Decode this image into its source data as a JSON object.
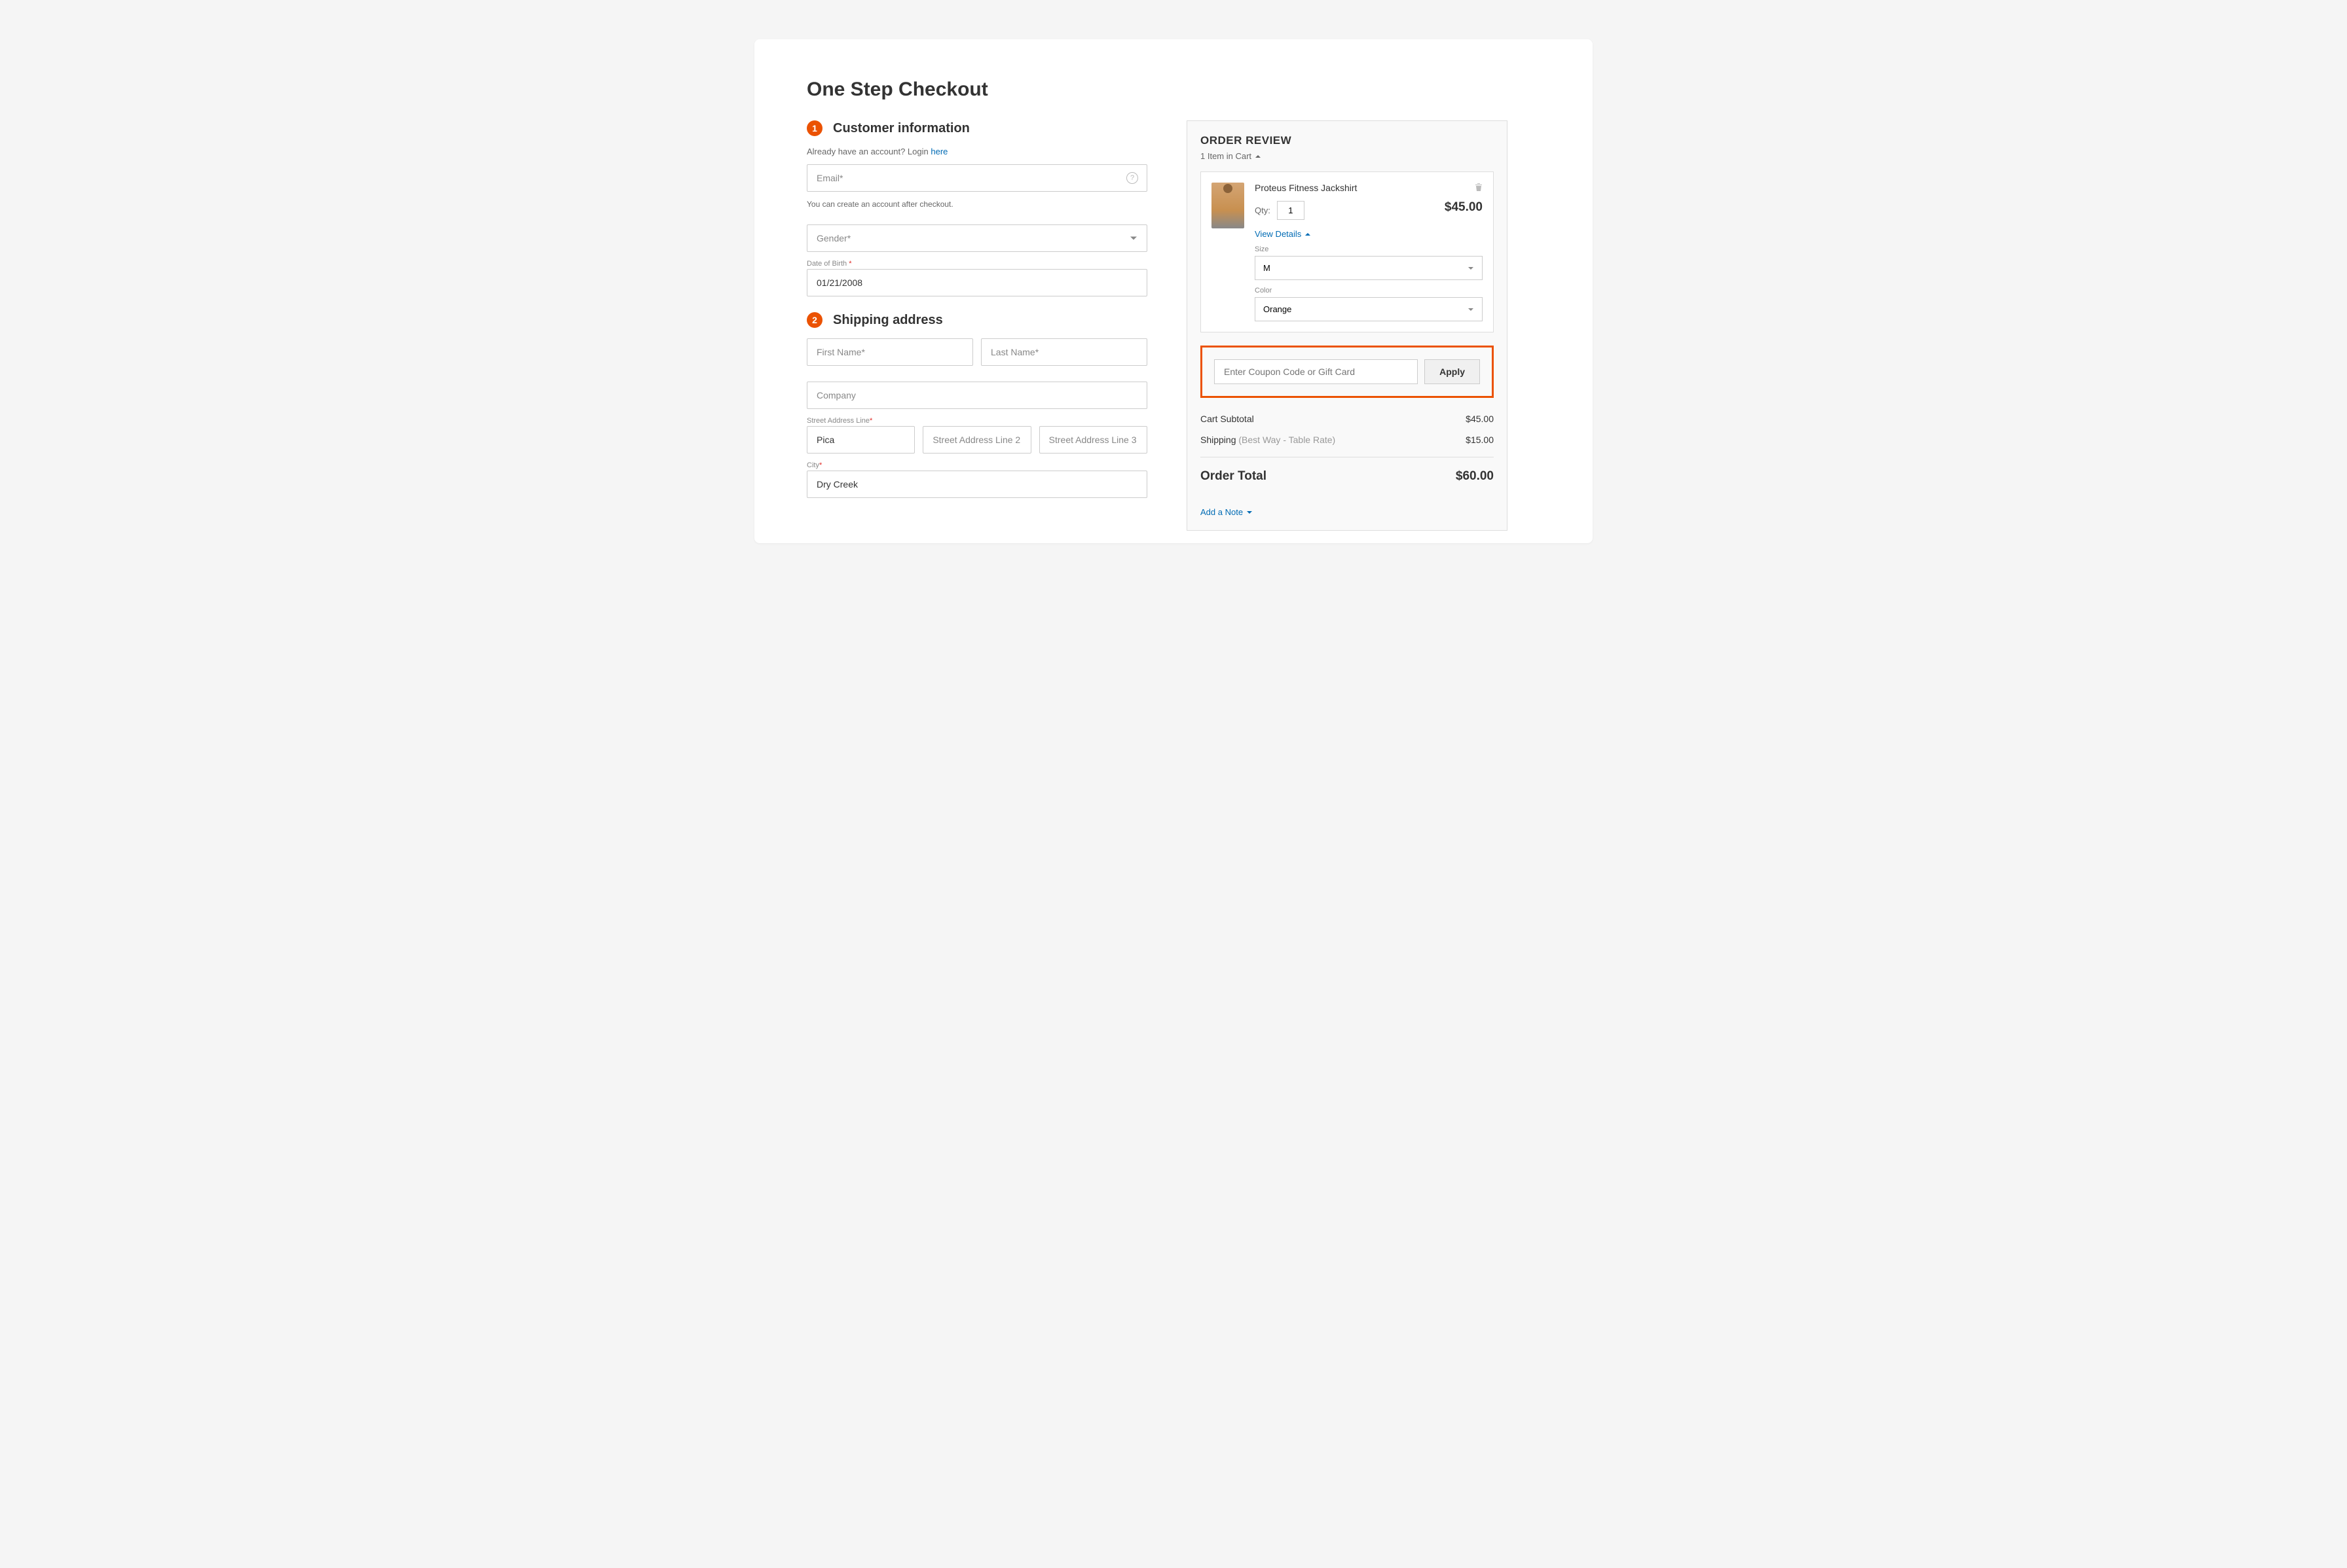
{
  "page": {
    "title": "One Step Checkout"
  },
  "customer": {
    "step": "1",
    "title": "Customer information",
    "login_prompt": "Already have an account? Login ",
    "login_link": "here",
    "email_placeholder": "Email",
    "email_note": "You can create an account after checkout.",
    "gender_placeholder": "Gender",
    "dob_label": "Date of Birth ",
    "dob_value": "01/21/2008"
  },
  "shipping": {
    "step": "2",
    "title": "Shipping address",
    "first_name_placeholder": "First Name",
    "last_name_placeholder": "Last Name",
    "company_placeholder": "Company",
    "street_label": "Street Address Line",
    "street1_value": "Pica",
    "street2_placeholder": "Street Address Line 2",
    "street3_placeholder": "Street Address Line 3",
    "city_label": "City",
    "city_value": "Dry Creek"
  },
  "review": {
    "title": "ORDER REVIEW",
    "cart_count": "1 Item in Cart",
    "item": {
      "name": "Proteus Fitness Jackshirt",
      "qty_label": "Qty:",
      "qty": "1",
      "price": "$45.00",
      "view_details": "View Details",
      "size_label": "Size",
      "size_value": "M",
      "color_label": "Color",
      "color_value": "Orange"
    },
    "coupon_placeholder": "Enter Coupon Code or Gift Card",
    "apply_label": "Apply",
    "subtotal_label": "Cart Subtotal",
    "subtotal_value": "$45.00",
    "shipping_label": "Shipping ",
    "shipping_method": "(Best Way - Table Rate)",
    "shipping_value": "$15.00",
    "total_label": "Order Total",
    "total_value": "$60.00",
    "add_note": "Add a Note"
  }
}
